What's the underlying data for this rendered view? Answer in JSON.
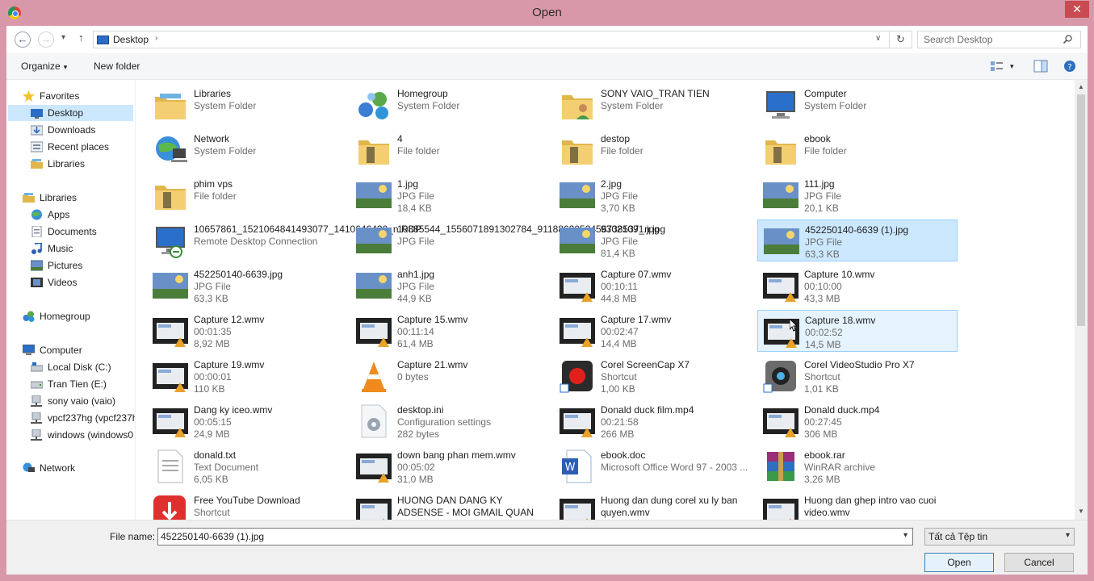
{
  "window": {
    "title": "Open",
    "close_glyph": "✕"
  },
  "nav": {
    "back_glyph": "←",
    "forward_glyph": "→",
    "recent_glyph": "▾",
    "up_glyph": "↑"
  },
  "address": {
    "location": "Desktop",
    "separator": "›",
    "dropdown": "∨",
    "refresh_glyph": "↻"
  },
  "search": {
    "placeholder": "Search Desktop"
  },
  "toolbar": {
    "organize": "Organize",
    "new_folder": "New folder",
    "caret": "▾"
  },
  "sidebar": {
    "items": [
      {
        "label": "Favorites",
        "icon": "star-icon",
        "level": 0
      },
      {
        "label": "Desktop",
        "icon": "desktop-icon",
        "level": 1,
        "selected": true
      },
      {
        "label": "Downloads",
        "icon": "downloads-icon",
        "level": 1
      },
      {
        "label": "Recent places",
        "icon": "recent-places-icon",
        "level": 1
      },
      {
        "label": "Libraries",
        "icon": "libraries-icon",
        "level": 1
      },
      {
        "label": "Libraries",
        "icon": "libraries-icon",
        "level": 0
      },
      {
        "label": "Apps",
        "icon": "apps-icon",
        "level": 1
      },
      {
        "label": "Documents",
        "icon": "documents-icon",
        "level": 1
      },
      {
        "label": "Music",
        "icon": "music-icon",
        "level": 1
      },
      {
        "label": "Pictures",
        "icon": "pictures-icon",
        "level": 1
      },
      {
        "label": "Videos",
        "icon": "videos-icon",
        "level": 1
      },
      {
        "label": "Homegroup",
        "icon": "homegroup-icon",
        "level": 0
      },
      {
        "label": "Computer",
        "icon": "computer-icon",
        "level": 0
      },
      {
        "label": "Local Disk (C:)",
        "icon": "local-disk-icon",
        "level": 1
      },
      {
        "label": "Tran Tien (E:)",
        "icon": "drive-icon",
        "level": 1
      },
      {
        "label": "sony vaio (vaio)",
        "icon": "network-drive-icon",
        "level": 1
      },
      {
        "label": "vpcf237hg (vpcf237h",
        "icon": "network-drive-icon",
        "level": 1
      },
      {
        "label": "windows (windows0",
        "icon": "network-drive-icon",
        "level": 1
      },
      {
        "label": "Network",
        "icon": "network-icon",
        "level": 0
      }
    ]
  },
  "files": [
    {
      "name": "Libraries",
      "line2": "System Folder",
      "line3": "",
      "icon": "libraries-icon"
    },
    {
      "name": "Homegroup",
      "line2": "System Folder",
      "line3": "",
      "icon": "homegroup-icon"
    },
    {
      "name": "SONY VAIO_TRAN TIEN",
      "line2": "System Folder",
      "line3": "",
      "icon": "user-folder-icon"
    },
    {
      "name": "Computer",
      "line2": "System Folder",
      "line3": "",
      "icon": "computer-icon"
    },
    {
      "name": "Network",
      "line2": "System Folder",
      "line3": "",
      "icon": "network-icon"
    },
    {
      "name": "4",
      "line2": "File folder",
      "line3": "",
      "icon": "folder-icon"
    },
    {
      "name": "destop",
      "line2": "File folder",
      "line3": "",
      "icon": "folder-icon"
    },
    {
      "name": "ebook",
      "line2": "File folder",
      "line3": "",
      "icon": "folder-icon"
    },
    {
      "name": "phim vps",
      "line2": "File folder",
      "line3": "",
      "icon": "folder-icon"
    },
    {
      "name": "1.jpg",
      "line2": "JPG File",
      "line3": "18,4 KB",
      "icon": "image-thumbnail-icon"
    },
    {
      "name": "2.jpg",
      "line2": "JPG File",
      "line3": "3,70 KB",
      "icon": "image-thumbnail-icon"
    },
    {
      "name": "111.jpg",
      "line2": "JPG File",
      "line3": "20,1 KB",
      "icon": "image-thumbnail-icon"
    },
    {
      "name": "10657861_1521064841493077_1410646430_n.RDP",
      "line2": "Remote Desktop Connection",
      "line3": "",
      "icon": "remote-desktop-icon"
    },
    {
      "name": "10885544_1556071891302784_9118862052456738537_n.jpg",
      "line2": "JPG File",
      "line3": "",
      "icon": "image-thumbnail-icon"
    },
    {
      "name": "93021091.jpg",
      "line2": "JPG File",
      "line3": "81,4 KB",
      "icon": "image-thumbnail-icon"
    },
    {
      "name": "452250140-6639 (1).jpg",
      "line2": "JPG File",
      "line3": "63,3 KB",
      "icon": "image-thumbnail-icon",
      "state": "selected"
    },
    {
      "name": "452250140-6639.jpg",
      "line2": "JPG File",
      "line3": "63,3 KB",
      "icon": "image-thumbnail-icon"
    },
    {
      "name": "anh1.jpg",
      "line2": "JPG File",
      "line3": "44,9 KB",
      "icon": "image-thumbnail-icon"
    },
    {
      "name": "Capture 07.wmv",
      "line2": "00:10:11",
      "line3": "44,8 MB",
      "icon": "video-thumbnail-icon"
    },
    {
      "name": "Capture 10.wmv",
      "line2": "00:10:00",
      "line3": "43,3 MB",
      "icon": "video-thumbnail-icon"
    },
    {
      "name": "Capture 12.wmv",
      "line2": "00:01:35",
      "line3": "8,92 MB",
      "icon": "video-thumbnail-icon"
    },
    {
      "name": "Capture 15.wmv",
      "line2": "00:11:14",
      "line3": "61,4 MB",
      "icon": "video-thumbnail-icon"
    },
    {
      "name": "Capture 17.wmv",
      "line2": "00:02:47",
      "line3": "14,4 MB",
      "icon": "video-thumbnail-icon"
    },
    {
      "name": "Capture 18.wmv",
      "line2": "00:02:52",
      "line3": "14,5 MB",
      "icon": "video-thumbnail-icon",
      "state": "hover"
    },
    {
      "name": "Capture 19.wmv",
      "line2": "00:00:01",
      "line3": "110 KB",
      "icon": "video-thumbnail-icon"
    },
    {
      "name": "Capture 21.wmv",
      "line2": "0 bytes",
      "line3": "",
      "icon": "vlc-icon"
    },
    {
      "name": "Corel ScreenCap X7",
      "line2": "Shortcut",
      "line3": "1,00 KB",
      "icon": "screencap-shortcut-icon"
    },
    {
      "name": "Corel VideoStudio Pro X7",
      "line2": "Shortcut",
      "line3": "1,01 KB",
      "icon": "videostudio-shortcut-icon"
    },
    {
      "name": "Dang ky iceo.wmv",
      "line2": "00:05:15",
      "line3": "24,9 MB",
      "icon": "video-thumbnail-icon"
    },
    {
      "name": "desktop.ini",
      "line2": "Configuration settings",
      "line3": "282 bytes",
      "icon": "settings-file-icon"
    },
    {
      "name": "Donald duck film.mp4",
      "line2": "00:21:58",
      "line3": "266 MB",
      "icon": "video-thumbnail-icon"
    },
    {
      "name": "Donald duck.mp4",
      "line2": "00:27:45",
      "line3": "306 MB",
      "icon": "video-thumbnail-icon"
    },
    {
      "name": "donald.txt",
      "line2": "Text Document",
      "line3": "6,05 KB",
      "icon": "text-file-icon"
    },
    {
      "name": "down bang phan mem.wmv",
      "line2": "00:05:02",
      "line3": "31,0 MB",
      "icon": "video-thumbnail-icon"
    },
    {
      "name": "ebook.doc",
      "line2": "Microsoft Office Word 97 - 2003 ...",
      "line3": "",
      "icon": "word-document-icon"
    },
    {
      "name": "ebook.rar",
      "line2": "WinRAR archive",
      "line3": "3,26 MB",
      "icon": "winrar-archive-icon"
    },
    {
      "name": "Free YouTube Download",
      "line2": "Shortcut",
      "line3": "",
      "icon": "youtube-download-shortcut-icon"
    },
    {
      "name": "HUONG DAN DANG KY ADSENSE - MOI GMAIL QUAN TRI CHO ADS...",
      "line2": "",
      "line3": "",
      "icon": "video-thumbnail-icon"
    },
    {
      "name": "Huong dan dung corel xu ly ban quyen.wmv",
      "line2": "",
      "line3": "",
      "icon": "video-thumbnail-icon"
    },
    {
      "name": "Huong dan ghep intro vao cuoi video.wmv",
      "line2": "",
      "line3": "",
      "icon": "video-thumbnail-icon"
    }
  ],
  "scrollbar": {
    "up": "▲",
    "down": "▼"
  },
  "bottom": {
    "file_name_label": "File name:",
    "file_name_value": "452250140-6639 (1).jpg",
    "file_name_dropdown": "▾",
    "file_type_value": "Tất cả Tệp tin",
    "file_type_dropdown": "▾",
    "open_label": "Open",
    "cancel_label": "Cancel"
  },
  "colors": {
    "frame": "#d998a9",
    "selection": "#cce8ff",
    "selection_border": "#99d1ff",
    "folder": "#f0c864",
    "close": "#c74b50"
  }
}
